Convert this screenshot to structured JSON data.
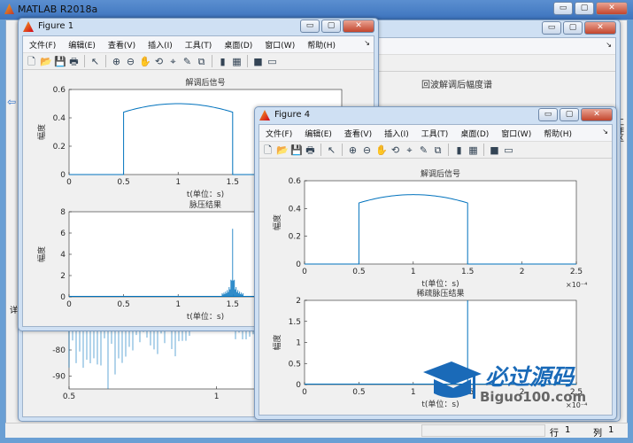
{
  "main_window": {
    "title": "MATLAB R2018a",
    "left_strip_label": "详",
    "right_strip_label": "工作区",
    "status": {
      "row_label": "行",
      "row": "1",
      "col_label": "列",
      "col": "1"
    }
  },
  "menu": [
    "文件(F)",
    "编辑(E)",
    "查看(V)",
    "插入(I)",
    "工具(T)",
    "桌面(D)",
    "窗口(W)",
    "帮助(H)"
  ],
  "toolbar_icons": [
    "new-icon",
    "open-icon",
    "save-icon",
    "print-icon",
    "pointer-icon",
    "zoom-in-icon",
    "zoom-out-icon",
    "pan-icon",
    "rotate-icon",
    "data-cursor-icon",
    "brush-icon",
    "link-icon",
    "colorbar-icon",
    "legend-icon",
    "hide-plot-tools-icon",
    "show-plot-tools-icon"
  ],
  "window_buttons": {
    "minimize": "▭",
    "maximize": "▢",
    "close": "✕"
  },
  "watermark": {
    "text_cn": "必过源码",
    "text_en": "Biguo100.com"
  },
  "chart_data": [
    {
      "figure": "背景图",
      "type": "line",
      "title": "回波解调后幅度谱",
      "xlim": [
        0.5,
        2
      ],
      "ylim": [
        -95,
        -65
      ],
      "xticks": [
        "0.5",
        "1",
        "1.5"
      ],
      "yticks": [
        "-70",
        "-80",
        "-90"
      ],
      "color": "#0072bd"
    },
    {
      "figure": "Figure 1",
      "type": "line",
      "title": "解调后信号",
      "xlabel": "t(单位：s)",
      "ylabel": "幅度",
      "xlim": [
        0,
        2.5
      ],
      "ylim": [
        0,
        0.6
      ],
      "xticks": [
        "0",
        "0.5",
        "1",
        "1.5"
      ],
      "yticks": [
        "0",
        "0.2",
        "0.4",
        "0.6"
      ],
      "pulse": {
        "start": 0.5,
        "end": 1.5,
        "edge_value": 0.44,
        "peak_value": 0.5
      },
      "color": "#0072bd"
    },
    {
      "figure": "Figure 1",
      "type": "line",
      "title": "脉压结果",
      "xlabel": "t(单位：s)",
      "ylabel": "幅度",
      "xlim": [
        0,
        2.5
      ],
      "ylim": [
        0,
        8
      ],
      "xticks": [
        "0",
        "0.5",
        "1",
        "1.5"
      ],
      "yticks": [
        "0",
        "2",
        "4",
        "6",
        "8"
      ],
      "peak": {
        "x": 1.5,
        "y": 6.4
      },
      "color": "#0072bd"
    },
    {
      "figure": "Figure 4",
      "type": "line",
      "title": "解调后信号",
      "xlabel": "t(单位：s)",
      "ylabel": "幅度",
      "x_exponent": "×10⁻⁴",
      "xlim": [
        0,
        2.5
      ],
      "ylim": [
        0,
        0.6
      ],
      "xticks": [
        "0",
        "0.5",
        "1",
        "1.5",
        "2",
        "2.5"
      ],
      "yticks": [
        "0",
        "0.2",
        "0.4",
        "0.6"
      ],
      "pulse": {
        "start": 0.5,
        "end": 1.5,
        "edge_value": 0.44,
        "peak_value": 0.5
      },
      "color": "#0072bd"
    },
    {
      "figure": "Figure 4",
      "type": "line",
      "title": "稀疏脉压结果",
      "xlabel": "t(单位：s)",
      "ylabel": "幅度",
      "x_exponent": "×10⁻⁴",
      "xlim": [
        0,
        2.5
      ],
      "ylim": [
        0,
        2
      ],
      "xticks": [
        "0",
        "0.5",
        "1",
        "1.5",
        "2",
        "2.5"
      ],
      "yticks": [
        "0",
        "0.5",
        "1",
        "1.5",
        "2"
      ],
      "peak": {
        "x": 1.5,
        "y": 2
      },
      "color": "#0072bd"
    }
  ],
  "figures": {
    "bg": {
      "title": ""
    },
    "fig1": {
      "title": "Figure 1"
    },
    "fig4": {
      "title": "Figure 4"
    }
  }
}
